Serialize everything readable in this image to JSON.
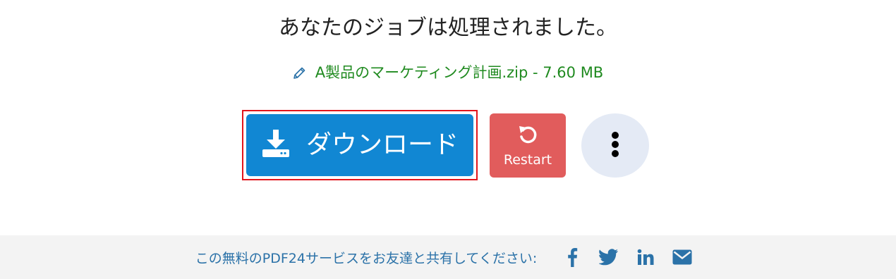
{
  "result": {
    "title": "あなたのジョブは処理されました。",
    "file_label": "A製品のマーケティング計画.zip - 7.60 MB"
  },
  "actions": {
    "download_label": "ダウンロード",
    "restart_label": "Restart",
    "more_icon": "vertical-ellipsis-icon",
    "download_icon": "download-icon",
    "restart_icon": "restart-icon",
    "edit_icon": "pencil-icon"
  },
  "footer": {
    "share_text": "この無料のPDF24サービスをお友達と共有してください:",
    "social_icons": [
      "facebook-icon",
      "twitter-icon",
      "linkedin-icon",
      "email-icon"
    ]
  },
  "colors": {
    "download_button": "#1187d3",
    "restart_button": "#e15c5c",
    "more_button": "#e4eaf5",
    "highlight_frame": "#e2151b",
    "file_text": "#1f8a1f",
    "footer_text": "#2b72a8",
    "footer_bg": "#f3f3f3"
  }
}
